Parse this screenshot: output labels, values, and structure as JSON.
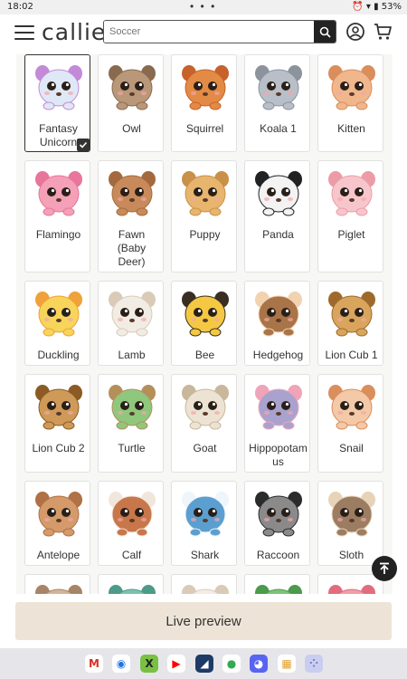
{
  "status": {
    "time": "18:02",
    "dots": "• • •",
    "battery": "53%"
  },
  "header": {
    "logo": "callie",
    "search_placeholder": "Soccer"
  },
  "grid": {
    "items": [
      {
        "label": "Fantasy Unicorn",
        "body": "#dfe8f6",
        "accent": "#c48ad8",
        "selected": true
      },
      {
        "label": "Owl",
        "body": "#b9987a",
        "accent": "#8a6a4e"
      },
      {
        "label": "Squirrel",
        "body": "#e38a45",
        "accent": "#c7622a"
      },
      {
        "label": "Koala 1",
        "body": "#b9bfc8",
        "accent": "#8c939c"
      },
      {
        "label": "Kitten",
        "body": "#f0b68c",
        "accent": "#d98e5b"
      },
      {
        "label": "Flamingo",
        "body": "#f4a0b8",
        "accent": "#e8769a"
      },
      {
        "label": "Fawn (Baby Deer)",
        "body": "#c88a5a",
        "accent": "#a46a3e"
      },
      {
        "label": "Puppy",
        "body": "#e7b56d",
        "accent": "#c99049"
      },
      {
        "label": "Panda",
        "body": "#f3f3f3",
        "accent": "#222222"
      },
      {
        "label": "Piglet",
        "body": "#f7c6cc",
        "accent": "#ec9ca7"
      },
      {
        "label": "Duckling",
        "body": "#f6d55a",
        "accent": "#f0a13a"
      },
      {
        "label": "Lamb",
        "body": "#f1ece4",
        "accent": "#d9cbb8"
      },
      {
        "label": "Bee",
        "body": "#f4c842",
        "accent": "#3a2e22"
      },
      {
        "label": "Hedgehog",
        "body": "#a87448",
        "accent": "#f2d3b0"
      },
      {
        "label": "Lion Cub 1",
        "body": "#d9a55d",
        "accent": "#9e6a2c"
      },
      {
        "label": "Lion Cub 2",
        "body": "#cf9a58",
        "accent": "#8c5a24"
      },
      {
        "label": "Turtle",
        "body": "#8fc77d",
        "accent": "#b58f5a"
      },
      {
        "label": "Goat",
        "body": "#ede3d3",
        "accent": "#c9b79b"
      },
      {
        "label": "Hippopotamus",
        "body": "#a9a2cf",
        "accent": "#f0a4b8"
      },
      {
        "label": "Snail",
        "body": "#f3c9a8",
        "accent": "#d98e5b"
      },
      {
        "label": "Antelope",
        "body": "#d49a6a",
        "accent": "#b07145"
      },
      {
        "label": "Calf",
        "body": "#c8774a",
        "accent": "#f1e6dc"
      },
      {
        "label": "Shark",
        "body": "#5b9fd0",
        "accent": "#eef5fb"
      },
      {
        "label": "Raccoon",
        "body": "#8a8a8a",
        "accent": "#2b2b2b"
      },
      {
        "label": "Sloth",
        "body": "#9c7d62",
        "accent": "#e7d3b8"
      },
      {
        "label": "",
        "body": "#d2b39a",
        "accent": "#a88466"
      },
      {
        "label": "",
        "body": "#7ec0b0",
        "accent": "#4c9a88"
      },
      {
        "label": "",
        "body": "#f1ece4",
        "accent": "#d9cbb8"
      },
      {
        "label": "",
        "body": "#7cc37a",
        "accent": "#4c9a4c"
      },
      {
        "label": "",
        "body": "#f29ca8",
        "accent": "#e26c7e"
      }
    ]
  },
  "preview": {
    "label": "Live preview"
  },
  "dock": {
    "apps": [
      {
        "name": "gmail-icon",
        "color": "#ffffff",
        "glyph": "M",
        "fg": "#d93025"
      },
      {
        "name": "chrome-icon",
        "color": "#ffffff",
        "glyph": "◉",
        "fg": "#1a73e8"
      },
      {
        "name": "x-app-icon",
        "color": "#7ac143",
        "glyph": "X",
        "fg": "#222222"
      },
      {
        "name": "youtube-icon",
        "color": "#ffffff",
        "glyph": "▶",
        "fg": "#ff0000"
      },
      {
        "name": "reader-app-icon",
        "color": "#1d3b66",
        "glyph": "◢",
        "fg": "#ffffff"
      },
      {
        "name": "maps-icon",
        "color": "#ffffff",
        "glyph": "●",
        "fg": "#34a853"
      },
      {
        "name": "discord-icon",
        "color": "#5865f2",
        "glyph": "◕",
        "fg": "#ffffff"
      },
      {
        "name": "gallery-icon",
        "color": "#ffffff",
        "glyph": "▦",
        "fg": "#e0a030"
      },
      {
        "name": "app-drawer-icon",
        "color": "#c9cdf0",
        "glyph": "⁘",
        "fg": "#6a72c9"
      }
    ]
  }
}
